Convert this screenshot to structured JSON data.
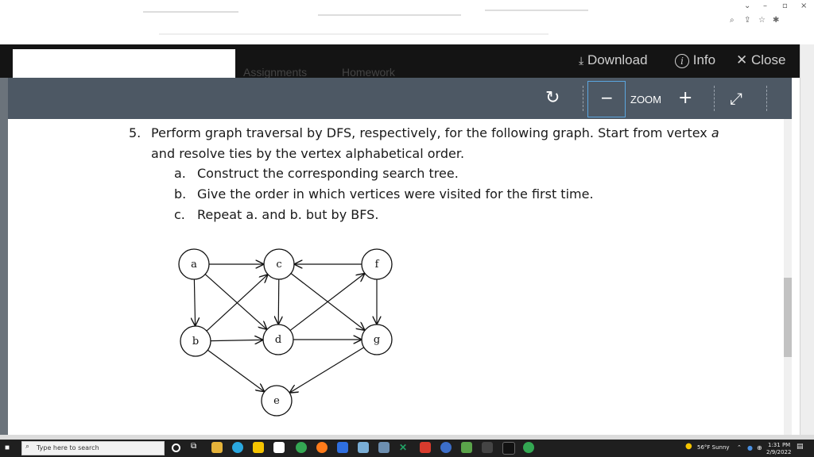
{
  "viewer": {
    "download_label": "Download",
    "info_label": "Info",
    "close_label": "Close",
    "zoom_label": "ZOOM",
    "zoom_minus": "−",
    "zoom_plus": "+",
    "ghost_tab_1": "Assignments",
    "ghost_tab_2": "Homework"
  },
  "question": {
    "number": "5.",
    "line1": "Perform graph traversal by DFS, respectively, for the following graph. Start from vertex ",
    "start_vertex": "a",
    "line2": "and resolve ties by the vertex alphabetical order.",
    "items": [
      {
        "marker": "a.",
        "text": "Construct the corresponding search tree."
      },
      {
        "marker": "b.",
        "text": "Give the order in which vertices were visited for the first time."
      },
      {
        "marker": "c.",
        "text": "Repeat a. and b. but by BFS."
      }
    ]
  },
  "graph": {
    "nodes": [
      "a",
      "b",
      "c",
      "d",
      "e",
      "f",
      "g"
    ],
    "edges": [
      [
        "a",
        "c"
      ],
      [
        "a",
        "b"
      ],
      [
        "a",
        "d"
      ],
      [
        "f",
        "c"
      ],
      [
        "f",
        "g"
      ],
      [
        "c",
        "d"
      ],
      [
        "c",
        "g"
      ],
      [
        "b",
        "c"
      ],
      [
        "b",
        "d"
      ],
      [
        "b",
        "e"
      ],
      [
        "d",
        "g"
      ],
      [
        "d",
        "f"
      ],
      [
        "g",
        "e"
      ]
    ]
  },
  "taskbar": {
    "search_placeholder": "Type here to search",
    "weather": "56°F  Sunny",
    "time": "1:31 PM",
    "date": "2/9/2022"
  },
  "colors": {
    "viewer_bar": "#141414",
    "toolbar": "#4d5864",
    "zoom_highlight": "#5ba6e0",
    "taskbar": "#1f1f1f"
  }
}
